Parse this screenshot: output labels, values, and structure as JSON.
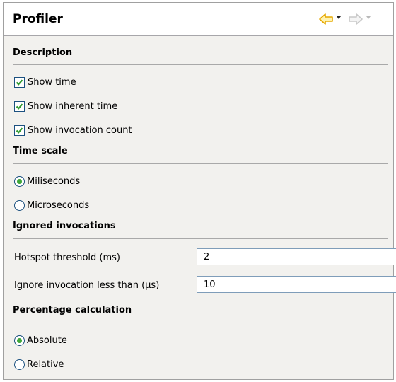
{
  "panel": {
    "title": "Profiler"
  },
  "nav": {
    "back_icon": "back-arrow-icon",
    "forward_icon": "forward-arrow-icon",
    "back_color": "#f0b400",
    "forward_enabled": false
  },
  "description": {
    "title": "Description",
    "options": [
      {
        "label": "Show time",
        "checked": true
      },
      {
        "label": "Show inherent time",
        "checked": true
      },
      {
        "label": "Show invocation count",
        "checked": true
      }
    ]
  },
  "time_scale": {
    "title": "Time scale",
    "options": [
      {
        "label": "Miliseconds",
        "selected": true
      },
      {
        "label": "Microseconds",
        "selected": false
      }
    ]
  },
  "ignored": {
    "title": "Ignored invocations",
    "hotspot_label": "Hotspot threshold (ms)",
    "hotspot_value": "2",
    "ignore_label": "Ignore invocation less than (µs)",
    "ignore_value": "10"
  },
  "percentage": {
    "title": "Percentage calculation",
    "options": [
      {
        "label": "Absolute",
        "selected": true
      },
      {
        "label": "Relative",
        "selected": false
      }
    ]
  },
  "colors": {
    "check_green": "#2f9a2f",
    "radio_green": "#3fa73a",
    "border_blue": "#1c5180"
  }
}
